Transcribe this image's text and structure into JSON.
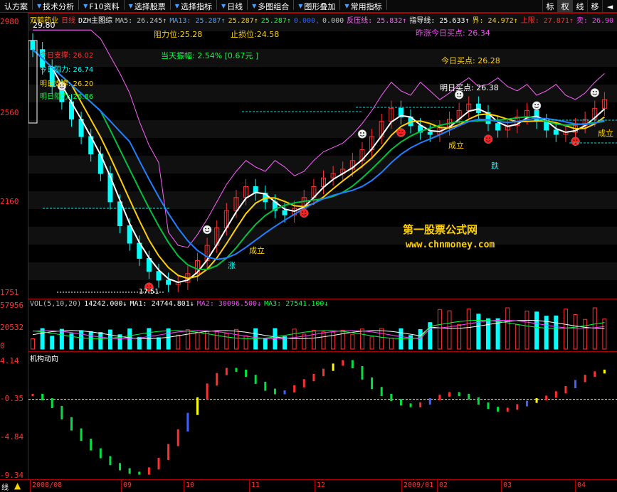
{
  "toolbar": {
    "items": [
      {
        "label": "认方案",
        "arrow": false
      },
      {
        "label": "技术分析",
        "arrow": true
      },
      {
        "label": "F10资料",
        "arrow": true
      },
      {
        "label": "选择股票",
        "arrow": true
      },
      {
        "label": "选择指标",
        "arrow": true
      },
      {
        "label": "日线",
        "arrow": true
      },
      {
        "label": "多图组合",
        "arrow": true
      },
      {
        "label": "图形叠加",
        "arrow": true
      },
      {
        "label": "常用指标",
        "arrow": true
      }
    ],
    "tabs": [
      "标",
      "权",
      "线",
      "移",
      "◄"
    ]
  },
  "stock": {
    "name": "双鹤药业",
    "period": "日线",
    "indicator": "DZH主图综"
  },
  "main_legend": [
    {
      "text": "MA5: 26.245↑",
      "color": "#c0c0c0"
    },
    {
      "text": "MA13: 25.287↑",
      "color": "#4aa0ff"
    },
    {
      "text": "25.287↑",
      "color": "#ffd000"
    },
    {
      "text": "25.287↑",
      "color": "#00ff40"
    },
    {
      "text": "0.000,",
      "color": "#3060ff"
    },
    {
      "text": "0.000",
      "color": "#c0c0c0"
    },
    {
      "text": "反压线: 25.832↑",
      "color": "#ff60ff"
    },
    {
      "text": "指导线: 25.633↑",
      "color": "#ffffff"
    },
    {
      "text": "界: 24.972↑",
      "color": "#ffd000"
    },
    {
      "text": "上限: 27.871↑",
      "color": "#ff3030"
    },
    {
      "text": "卖: 26.90",
      "color": "#ff40ff"
    }
  ],
  "y_axis": {
    "main": [
      "2980",
      "2560",
      "2160",
      "1751"
    ],
    "volume": [
      "57956",
      "20532",
      "0"
    ],
    "indicator": [
      "4.14",
      "-0.35",
      "-4.84",
      "-9.34"
    ]
  },
  "annotations": {
    "high_price": "29.80",
    "low_price": "17.51",
    "resistance": "阻力位:25.28",
    "stop_loss": "止损位:24.58",
    "amplitude": "当天振幅: 2.54%   [0.67元 ]",
    "yesterday_buy": "昨涨今日买点: 26.34",
    "today_buy": "今日买点:  26.28",
    "tomorrow_buy": "明日买点:  26.38",
    "left1": "今日支撑: 26.02",
    "left2": "今日阻力: 26.74",
    "left3": "明日支撑: 26.20",
    "left4": "明日阻力: 26.86",
    "watermark_cn": "第一股票公式网",
    "watermark_url": "www.chnmoney.com",
    "chengli": "成立",
    "zhang": "涨",
    "die": "跌"
  },
  "volume_legend": [
    {
      "text": "VOL(5,10,20)",
      "color": "#c0c0c0"
    },
    {
      "text": "14242.000↓",
      "color": "#ffffff"
    },
    {
      "text": "MA1: 24744.801↓",
      "color": "#ffffff"
    },
    {
      "text": "MA2: 30096.500↓",
      "color": "#ff40ff"
    },
    {
      "text": "MA3: 27541.100↓",
      "color": "#00ff40"
    }
  ],
  "indicator_title": "机构动向",
  "dates": [
    "2008/08",
    "09",
    "10",
    "11",
    "12",
    "2009/01",
    "02",
    "03",
    "04"
  ],
  "bottom_left": "线",
  "colors": {
    "up": "#ff3030",
    "down": "#00ffff",
    "axis": "#aa0000",
    "ma5": "#ffffff",
    "ma13": "#ffd000",
    "ma_green": "#00c040",
    "ma_blue": "#2080ff",
    "resist": "#ff60ff"
  },
  "chart_data": {
    "type": "line",
    "series": [
      {
        "name": "close",
        "values": [
          28.6,
          27.8,
          26.9,
          26.2,
          25.4,
          24.6,
          23.8,
          22.9,
          21.6,
          20.5,
          19.7,
          19.0,
          18.4,
          18.0,
          17.8,
          17.9,
          18.3,
          18.9,
          19.6,
          20.4,
          21.2,
          21.8,
          22.3,
          22.0,
          21.6,
          21.2,
          21.0,
          21.3,
          21.8,
          22.3,
          22.7,
          22.9,
          23.1,
          23.5,
          24.0,
          24.6,
          25.3,
          25.9,
          25.5,
          25.1,
          24.8,
          24.7,
          25.0,
          25.4,
          25.8,
          26.1,
          25.7,
          25.2,
          24.9,
          25.1,
          25.5,
          25.8,
          25.3,
          24.9,
          24.7,
          24.8,
          25.1,
          25.4,
          25.9,
          26.3
        ]
      },
      {
        "name": "indicator",
        "values": [
          0.2,
          -0.3,
          -1.2,
          -2.5,
          -3.8,
          -5.0,
          -6.1,
          -7.0,
          -7.8,
          -8.4,
          -8.8,
          -8.9,
          -8.3,
          -7.2,
          -5.6,
          -3.9,
          -2.0,
          -0.2,
          1.4,
          2.6,
          3.2,
          3.0,
          2.4,
          1.6,
          0.8,
          0.4,
          0.6,
          1.2,
          1.9,
          2.5,
          3.1,
          3.7,
          4.1,
          3.4,
          2.1,
          1.0,
          0.2,
          -0.4,
          -0.9,
          -1.1,
          -0.8,
          -0.3,
          0.1,
          0.4,
          0.2,
          -0.2,
          -0.8,
          -1.3,
          -1.6,
          -1.4,
          -1.0,
          -0.6,
          -0.3,
          0.0,
          0.5,
          1.1,
          1.8,
          2.4,
          2.8,
          3.0
        ]
      }
    ],
    "ylim_main": [
      17.51,
      29.8
    ],
    "ylim_indicator": [
      -9.34,
      4.14
    ]
  }
}
